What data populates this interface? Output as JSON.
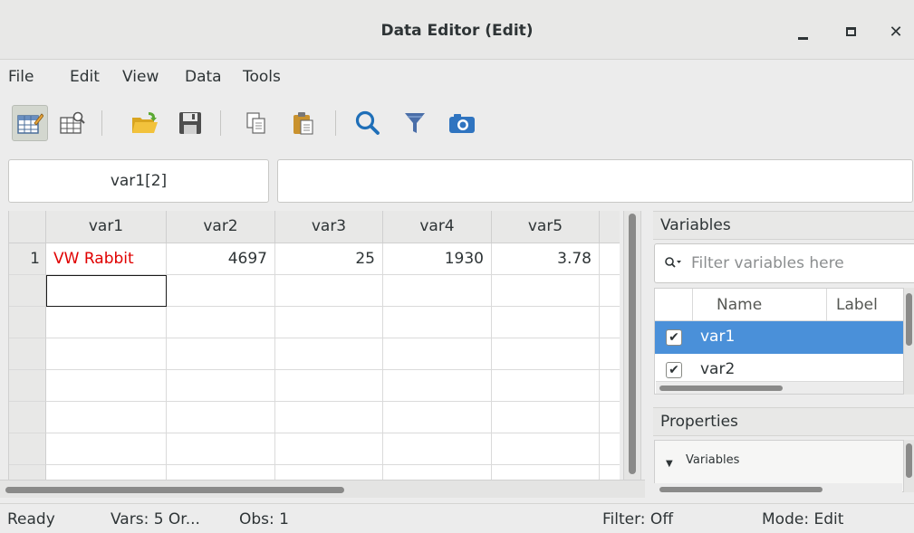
{
  "window": {
    "title": "Data Editor (Edit)",
    "controls": {
      "minimize": "_",
      "maximize": "□",
      "close": "✕"
    }
  },
  "menu": [
    "File",
    "Edit",
    "View",
    "Data",
    "Tools"
  ],
  "toolbar": {
    "icons": [
      "data-editor-edit-icon",
      "data-browser-icon",
      "open-folder-icon",
      "save-icon",
      "copy-icon",
      "paste-icon",
      "search-icon",
      "filter-icon",
      "snapshot-icon"
    ]
  },
  "cell_ref": "var1[2]",
  "cell_value": "",
  "grid": {
    "columns": [
      "var1",
      "var2",
      "var3",
      "var4",
      "var5"
    ],
    "rows": [
      {
        "num": "1",
        "cells": [
          "VW Rabbit",
          "4697",
          "25",
          "1930",
          "3.78"
        ]
      }
    ]
  },
  "variables_panel": {
    "title": "Variables",
    "filter_placeholder": "Filter variables here",
    "headers": [
      "Name",
      "Label"
    ],
    "items": [
      {
        "name": "var1",
        "checked": true,
        "selected": true
      },
      {
        "name": "var2",
        "checked": true,
        "selected": false
      }
    ]
  },
  "properties_panel": {
    "title": "Properties",
    "section": "Variables"
  },
  "status": {
    "ready": "Ready",
    "vars": "Vars: 5  Or...",
    "obs": "Obs: 1",
    "filter": "Filter: Off",
    "mode": "Mode: Edit"
  },
  "colors": {
    "selection": "#4a90d9",
    "string_text": "#e00000"
  }
}
